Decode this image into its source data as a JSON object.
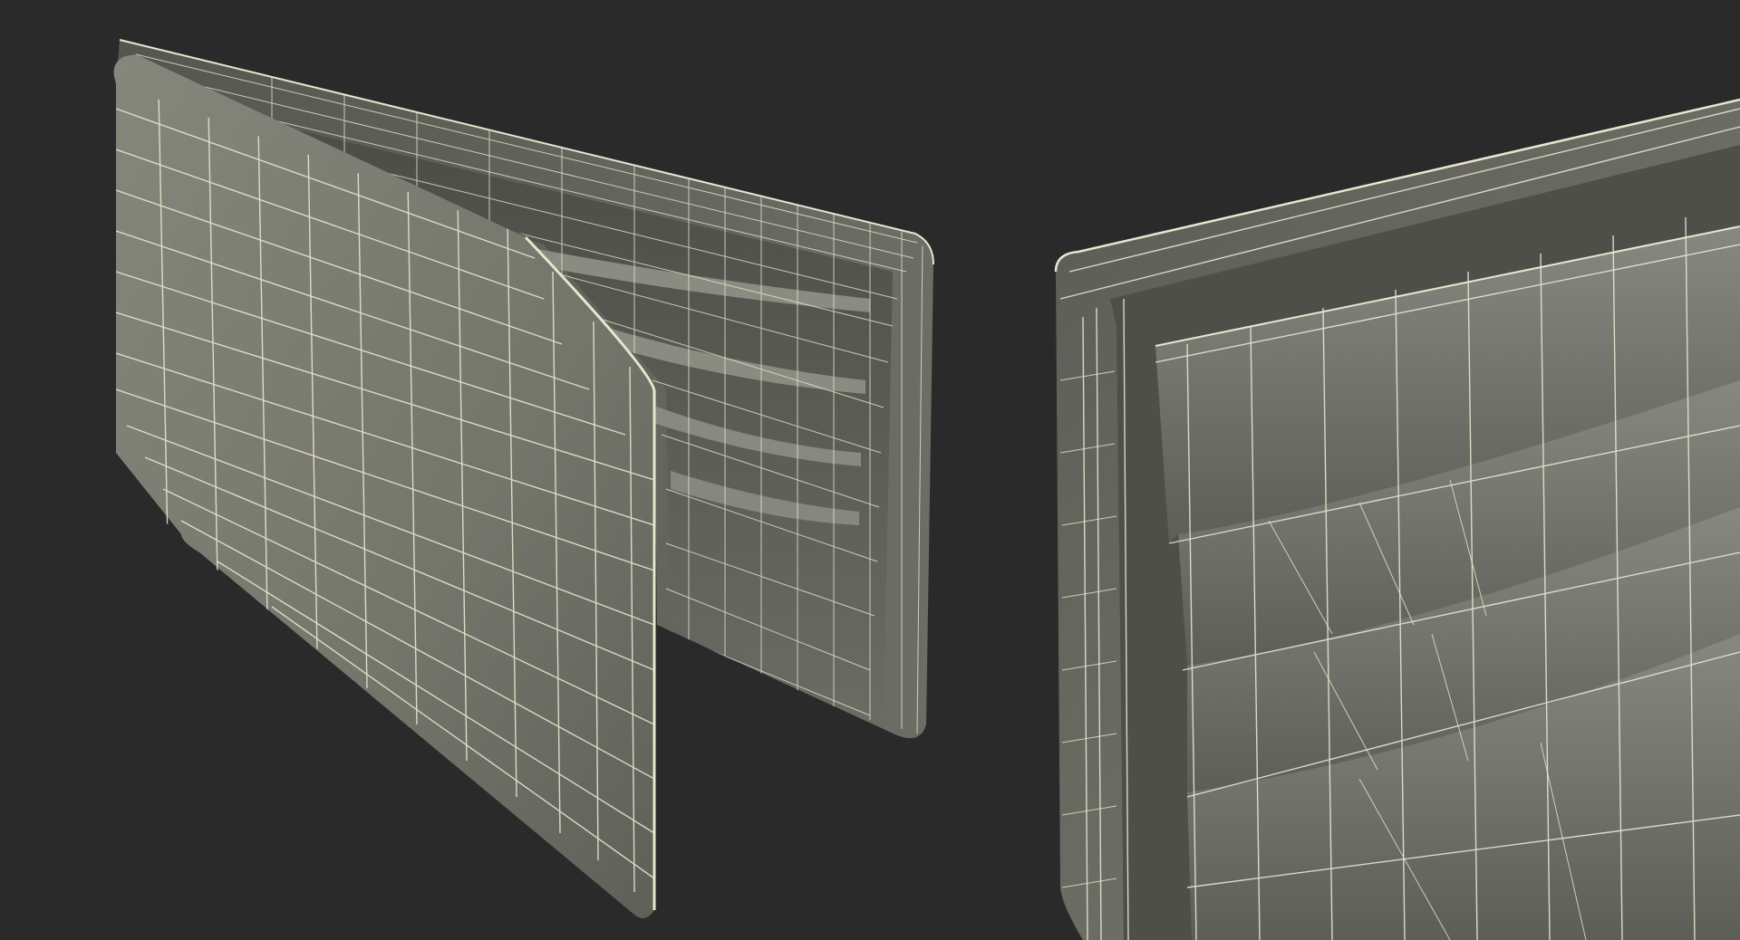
{
  "scene": {
    "background_color": "#2a2a2a",
    "surface_color": "#75766c",
    "surface_shadow_color": "#4c4d46",
    "wireframe_color": "#e9e6cf",
    "views": [
      {
        "id": "left-view",
        "subject": "bifold-wallet-wireframe-render"
      },
      {
        "id": "right-view",
        "subject": "wallet-card-slots-closeup-wireframe-render"
      }
    ]
  }
}
